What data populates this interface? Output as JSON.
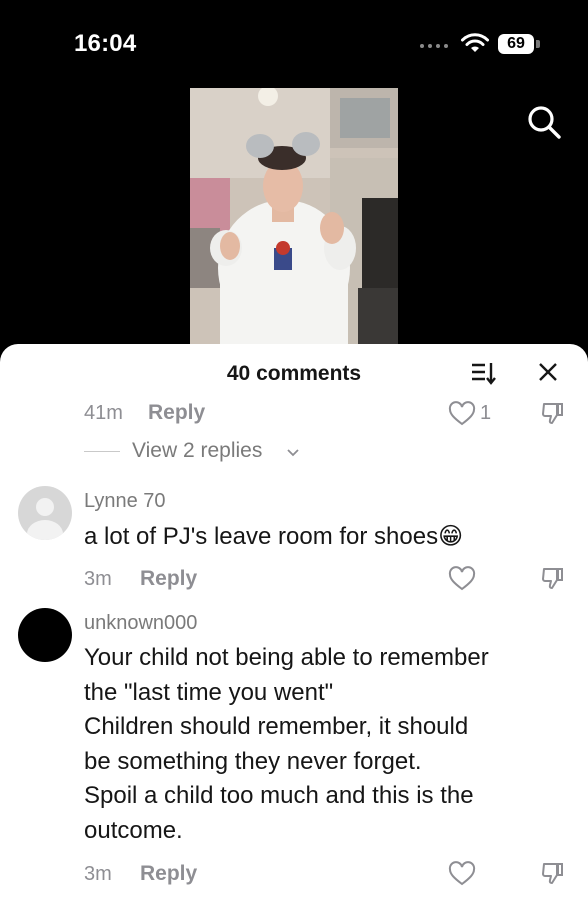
{
  "status": {
    "time": "16:04",
    "battery": "69"
  },
  "comments_panel": {
    "title": "40 comments",
    "top_comment": {
      "age": "41m",
      "reply_label": "Reply",
      "likes": "1",
      "view_replies": "View 2 replies"
    },
    "comments": [
      {
        "username": "Lynne 70",
        "text": "a lot of PJ's leave room for shoes😁",
        "age": "3m",
        "reply_label": "Reply",
        "avatar": "default-avatar"
      },
      {
        "username": "unknown000",
        "text_lines": [
          "Your child not being able to remember",
          "the \"last time you went\"",
          "Children should remember, it should",
          "be something they never forget.",
          "Spoil a child too much and this is the",
          "outcome."
        ],
        "age": "3m",
        "reply_label": "Reply",
        "avatar": "black-avatar"
      }
    ]
  },
  "icons": [
    "search-icon",
    "wifi-icon",
    "sort-icon",
    "close-icon",
    "heart-icon",
    "dislike-icon",
    "chevron-down-icon"
  ]
}
